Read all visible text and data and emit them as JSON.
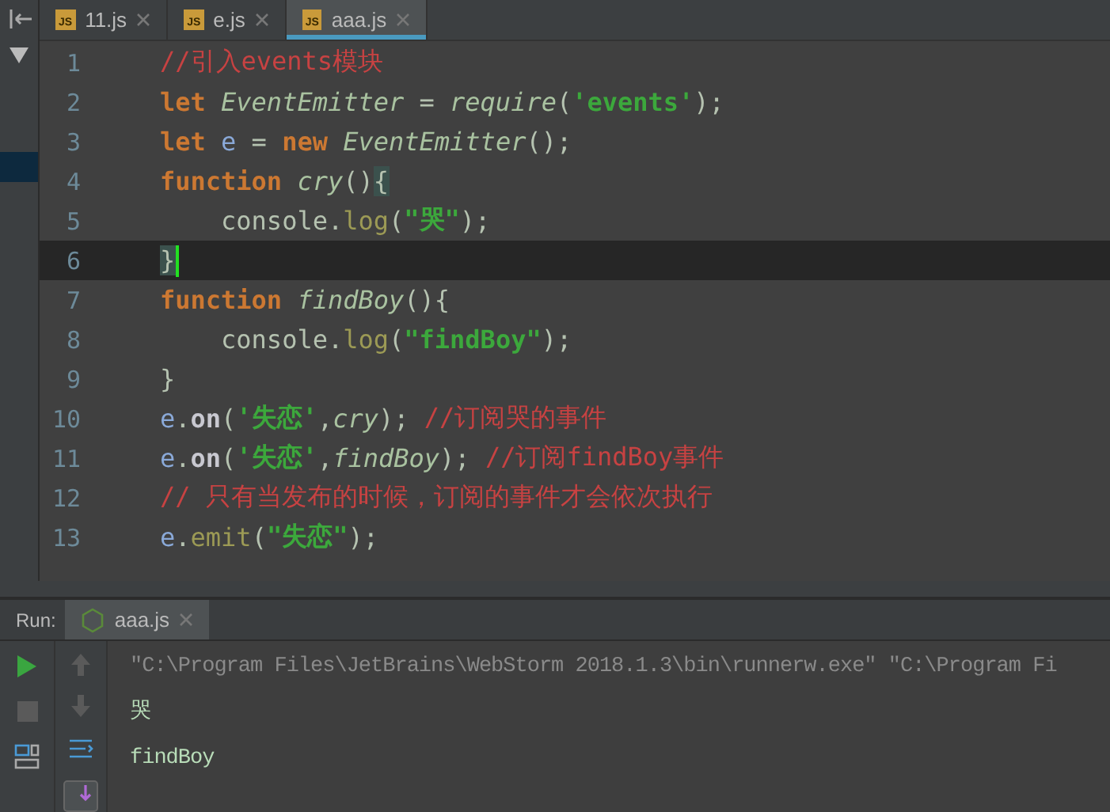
{
  "tabs": [
    {
      "label": "11.js",
      "badge": "JS",
      "selected": false
    },
    {
      "label": "e.js",
      "badge": "JS",
      "selected": false
    },
    {
      "label": "aaa.js",
      "badge": "JS",
      "selected": true
    }
  ],
  "editor": {
    "lines": [
      {
        "number": "1",
        "current": false,
        "tokens": [
          {
            "kind": "comment",
            "text": "//引入events模块"
          }
        ]
      },
      {
        "number": "2",
        "current": false,
        "tokens": [
          {
            "kind": "keyword",
            "text": "let "
          },
          {
            "kind": "italic",
            "text": "EventEmitter"
          },
          {
            "kind": "plain",
            "text": " = "
          },
          {
            "kind": "italic",
            "text": "require"
          },
          {
            "kind": "plain",
            "text": "("
          },
          {
            "kind": "string",
            "text": "'events'"
          },
          {
            "kind": "plain",
            "text": ");"
          }
        ]
      },
      {
        "number": "3",
        "current": false,
        "tokens": [
          {
            "kind": "keyword",
            "text": "let "
          },
          {
            "kind": "variable",
            "text": "e"
          },
          {
            "kind": "plain",
            "text": " = "
          },
          {
            "kind": "keyword",
            "text": "new "
          },
          {
            "kind": "italic",
            "text": "EventEmitter"
          },
          {
            "kind": "plain",
            "text": "();"
          }
        ]
      },
      {
        "number": "4",
        "current": false,
        "tokens": [
          {
            "kind": "keyword",
            "text": "function "
          },
          {
            "kind": "italic",
            "text": "cry"
          },
          {
            "kind": "plain",
            "text": "()"
          },
          {
            "kind": "brace-match",
            "text": "{"
          }
        ]
      },
      {
        "number": "5",
        "current": false,
        "tokens": [
          {
            "kind": "plain",
            "text": "    console."
          },
          {
            "kind": "method",
            "text": "log"
          },
          {
            "kind": "plain",
            "text": "("
          },
          {
            "kind": "string",
            "text": "\"哭\""
          },
          {
            "kind": "plain",
            "text": ");"
          }
        ]
      },
      {
        "number": "6",
        "current": true,
        "tokens": [
          {
            "kind": "brace-match",
            "text": "}"
          }
        ]
      },
      {
        "number": "7",
        "current": false,
        "tokens": [
          {
            "kind": "keyword",
            "text": "function "
          },
          {
            "kind": "italic",
            "text": "findBoy"
          },
          {
            "kind": "plain",
            "text": "(){"
          }
        ]
      },
      {
        "number": "8",
        "current": false,
        "tokens": [
          {
            "kind": "plain",
            "text": "    console."
          },
          {
            "kind": "method",
            "text": "log"
          },
          {
            "kind": "plain",
            "text": "("
          },
          {
            "kind": "string",
            "text": "\"findBoy\""
          },
          {
            "kind": "plain",
            "text": ");"
          }
        ]
      },
      {
        "number": "9",
        "current": false,
        "tokens": [
          {
            "kind": "plain",
            "text": "}"
          }
        ]
      },
      {
        "number": "10",
        "current": false,
        "tokens": [
          {
            "kind": "variable",
            "text": "e"
          },
          {
            "kind": "plain",
            "text": "."
          },
          {
            "kind": "call",
            "text": "on"
          },
          {
            "kind": "plain",
            "text": "("
          },
          {
            "kind": "string",
            "text": "'失恋'"
          },
          {
            "kind": "plain",
            "text": ","
          },
          {
            "kind": "italic",
            "text": "cry"
          },
          {
            "kind": "plain",
            "text": "); "
          },
          {
            "kind": "comment",
            "text": "//订阅哭的事件"
          }
        ]
      },
      {
        "number": "11",
        "current": false,
        "tokens": [
          {
            "kind": "variable",
            "text": "e"
          },
          {
            "kind": "plain",
            "text": "."
          },
          {
            "kind": "call",
            "text": "on"
          },
          {
            "kind": "plain",
            "text": "("
          },
          {
            "kind": "string",
            "text": "'失恋'"
          },
          {
            "kind": "plain",
            "text": ","
          },
          {
            "kind": "italic",
            "text": "findBoy"
          },
          {
            "kind": "plain",
            "text": "); "
          },
          {
            "kind": "comment",
            "text": "//订阅findBoy事件"
          }
        ]
      },
      {
        "number": "12",
        "current": false,
        "tokens": [
          {
            "kind": "comment",
            "text": "// 只有当发布的时候，订阅的事件才会依次执行"
          }
        ]
      },
      {
        "number": "13",
        "current": false,
        "tokens": [
          {
            "kind": "variable",
            "text": "e"
          },
          {
            "kind": "plain",
            "text": "."
          },
          {
            "kind": "method",
            "text": "emit"
          },
          {
            "kind": "plain",
            "text": "("
          },
          {
            "kind": "string",
            "text": "\"失恋\""
          },
          {
            "kind": "plain",
            "text": ");"
          }
        ]
      }
    ]
  },
  "run_panel": {
    "label": "Run:",
    "tab": {
      "label": "aaa.js",
      "selected": true
    },
    "console": [
      {
        "kind": "command",
        "text": "\"C:\\Program Files\\JetBrains\\WebStorm 2018.1.3\\bin\\runnerw.exe\" \"C:\\Program Fi"
      },
      {
        "kind": "output",
        "text": "哭"
      },
      {
        "kind": "output",
        "text": "findBoy"
      }
    ]
  }
}
